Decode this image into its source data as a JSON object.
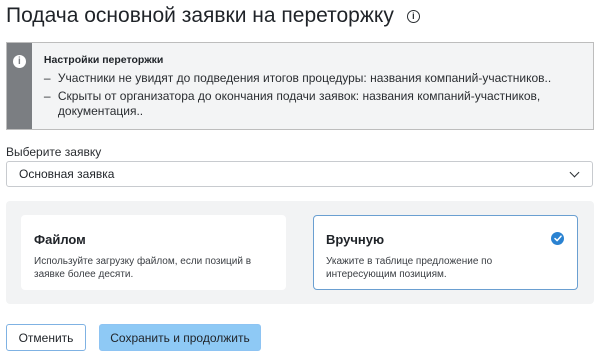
{
  "page": {
    "title": "Подача основной заявки на переторжку",
    "title_icon": "info-icon"
  },
  "notice": {
    "icon": "info-icon",
    "heading": "Настройки переторжки",
    "items": [
      "Участники не увидят до подведения итогов процедуры: названия компаний-участников..",
      "Скрыты от организатора до окончания подачи заявок: названия компаний-участников, документация.."
    ]
  },
  "select": {
    "label": "Выберите заявку",
    "value": "Основная заявка",
    "icon": "chevron-down-icon"
  },
  "options": [
    {
      "title": "Файлом",
      "description": "Используйте загрузку файлом, если позиций в заявке более десяти.",
      "selected": false
    },
    {
      "title": "Вручную",
      "description": "Укажите в таблице предложение по интересующим позициям.",
      "selected": true
    }
  ],
  "actions": {
    "cancel_label": "Отменить",
    "save_label": "Сохранить и продолжить"
  },
  "colors": {
    "accent": "#2a82d1",
    "primary_button": "#8ec9f5",
    "notice_bar": "#7b7e82",
    "selected_border": "#6a9fd1"
  }
}
